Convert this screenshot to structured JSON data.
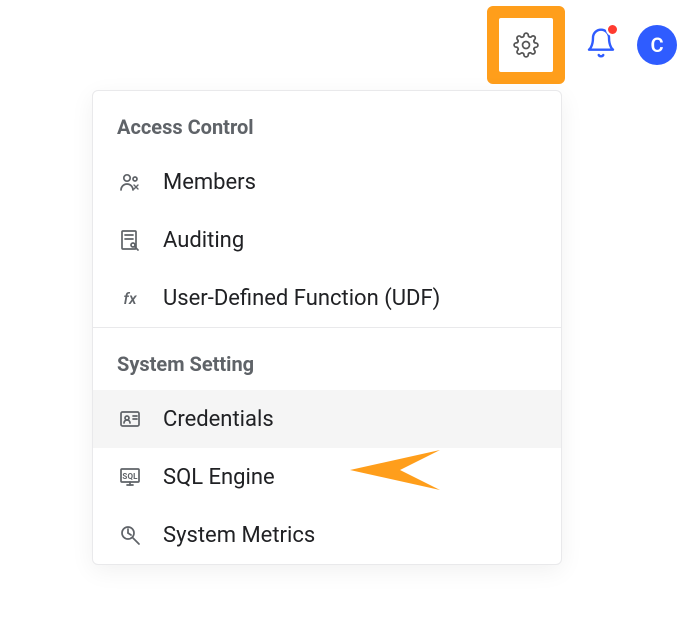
{
  "topbar": {
    "avatar_letter": "C"
  },
  "dropdown": {
    "sections": [
      {
        "title": "Access Control",
        "items": [
          {
            "label": "Members",
            "highlight": false
          },
          {
            "label": "Auditing",
            "highlight": false
          },
          {
            "label": "User-Defined Function (UDF)",
            "highlight": false
          }
        ]
      },
      {
        "title": "System Setting",
        "items": [
          {
            "label": "Credentials",
            "highlight": true
          },
          {
            "label": "SQL Engine",
            "highlight": false
          },
          {
            "label": "System Metrics",
            "highlight": false
          }
        ]
      }
    ]
  },
  "highlight_color": "#ff9e1b"
}
